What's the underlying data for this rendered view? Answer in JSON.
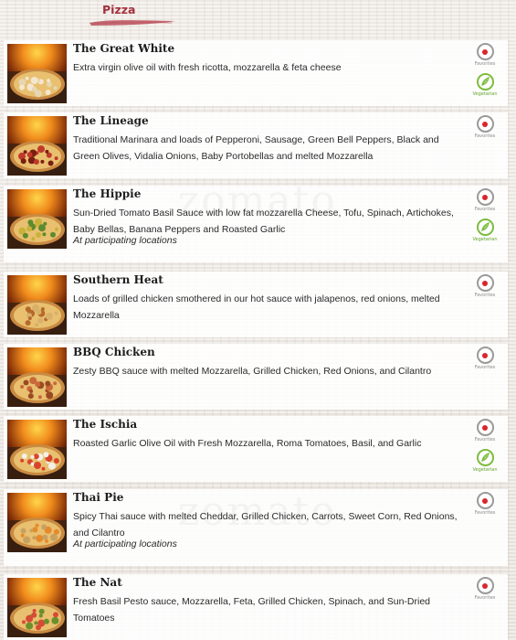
{
  "section": {
    "title": "Pizza"
  },
  "watermark": "zomato",
  "labels": {
    "favorites": "Favorites",
    "vegetarian": "Vegetarian"
  },
  "icons": {
    "favorites": "favorites-red-dot-icon",
    "vegetarian": "vegetarian-leaf-icon"
  },
  "colors": {
    "section_title": "#a3313d",
    "favorites_dot": "#d9262d",
    "vegetarian_green": "#7cbd3e"
  },
  "items": [
    {
      "name": "The Great White",
      "description": "Extra virgin olive oil with fresh ricotta, mozzarella & feta cheese",
      "note": "",
      "vegetarian": true
    },
    {
      "name": "The Lineage",
      "description": "Traditional Marinara and loads of Pepperoni, Sausage, Green Bell Peppers, Black and Green Olives, Vidalia Onions, Baby Portobellas and melted Mozzarella",
      "note": "",
      "vegetarian": false
    },
    {
      "name": "The Hippie",
      "description": "Sun-Dried Tomato Basil Sauce with low fat mozzarella Cheese, Tofu, Spinach, Artichokes, Baby Bellas, Banana Peppers and Roasted Garlic",
      "note": "At participating locations",
      "vegetarian": true
    },
    {
      "name": "Southern Heat",
      "description": "Loads of grilled chicken smothered in our hot sauce with jalapenos, red onions, melted Mozzarella",
      "note": "",
      "vegetarian": false
    },
    {
      "name": "BBQ Chicken",
      "description": "Zesty BBQ sauce with melted Mozzarella, Grilled Chicken, Red Onions, and Cilantro",
      "note": "",
      "vegetarian": false
    },
    {
      "name": "The Ischia",
      "description": "Roasted Garlic Olive Oil with Fresh Mozzarella, Roma Tomatoes, Basil, and Garlic",
      "note": "",
      "vegetarian": true
    },
    {
      "name": "Thai Pie",
      "description": "Spicy Thai sauce with melted Cheddar, Grilled Chicken, Carrots, Sweet Corn, Red Onions, and Cilantro",
      "note": "At participating locations",
      "vegetarian": false
    },
    {
      "name": "The Nat",
      "description": "Fresh Basil Pesto sauce, Mozzarella, Feta, Grilled Chicken, Spinach, and Sun-Dried Tomatoes",
      "note": "",
      "vegetarian": false
    }
  ]
}
